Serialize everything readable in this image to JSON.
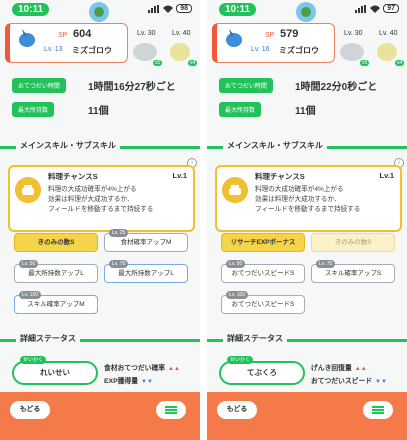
{
  "panels": [
    {
      "status": {
        "time": "10:11",
        "battery": "98"
      },
      "pokemon": {
        "sp_label": "SP",
        "sp": "604",
        "level": "Lv. 13",
        "name": "ミズゴロウ"
      },
      "team": {
        "mid_level": "Lv. 30",
        "right_level": "Lv. 40",
        "mid_count": "x5",
        "right_count": "x4"
      },
      "stats": {
        "freq_label": "おてつだい時間",
        "freq_value": "1時間16分27秒ごと",
        "carry_label": "最大所持数",
        "carry_value": "11個"
      },
      "section_skill": "メインスキル・サブスキル",
      "skill": {
        "name": "料理チャンスS",
        "level": "Lv.1",
        "desc1": "料理の大成功確率が4%上がる",
        "desc2": "効果は料理が大成功するか、",
        "desc3": "フィールドを移動するまで持続する"
      },
      "subskills": [
        {
          "label": "きのみの数S",
          "lv": "",
          "type": "gold"
        },
        {
          "label": "食材確率アップM",
          "lv": "Lv. 25",
          "type": "grey"
        },
        {
          "label": "最大所持数アップL",
          "lv": "Lv. 50",
          "type": "grey"
        },
        {
          "label": "最大所持数アップL",
          "lv": "Lv. 75",
          "type": "grey"
        },
        {
          "label": "スキル確率アップM",
          "lv": "Lv. 100",
          "type": "grey"
        }
      ],
      "section_stats": "詳細ステータス",
      "nature": {
        "tag": "せいかく",
        "name": "れいせい",
        "up": "食材おてつだい確率",
        "down": "EXP獲得量"
      },
      "bottom": {
        "back": "もどる"
      }
    },
    {
      "status": {
        "time": "10:11",
        "battery": "97"
      },
      "pokemon": {
        "sp_label": "SP",
        "sp": "579",
        "level": "Lv. 16",
        "name": "ミズゴロウ"
      },
      "team": {
        "mid_level": "Lv. 30",
        "right_level": "Lv. 40",
        "mid_count": "x5",
        "right_count": "x4"
      },
      "stats": {
        "freq_label": "おてつだい時間",
        "freq_value": "1時間22分0秒ごと",
        "carry_label": "最大所持数",
        "carry_value": "11個"
      },
      "section_skill": "メインスキル・サブスキル",
      "skill": {
        "name": "料理チャンスS",
        "level": "Lv.1",
        "desc1": "料理の大成功確率が4%上がる",
        "desc2": "効果は料理が大成功するか、",
        "desc3": "フィールドを移動するまで持続する"
      },
      "subskills": [
        {
          "label": "リサーチEXPボーナス",
          "lv": "",
          "type": "gold"
        },
        {
          "label": "きのみの数S",
          "lv": "",
          "type": "pale"
        },
        {
          "label": "おてつだいスピードS",
          "lv": "Lv. 50",
          "type": "grey"
        },
        {
          "label": "スキル確率アップS",
          "lv": "Lv. 75",
          "type": "grey"
        },
        {
          "label": "おてつだいスピードS",
          "lv": "Lv. 100",
          "type": "grey"
        }
      ],
      "section_stats": "詳細ステータス",
      "nature": {
        "tag": "せいかく",
        "name": "てぶくろ",
        "up": "げんき回復量",
        "down": "おてつだいスピード"
      },
      "bottom": {
        "back": "もどる"
      }
    }
  ],
  "colors": {
    "accent": "#22c25a",
    "skill_border": "#f0c030",
    "bottom_bar": "#f47a4a",
    "team_border": "#f05a3a"
  }
}
